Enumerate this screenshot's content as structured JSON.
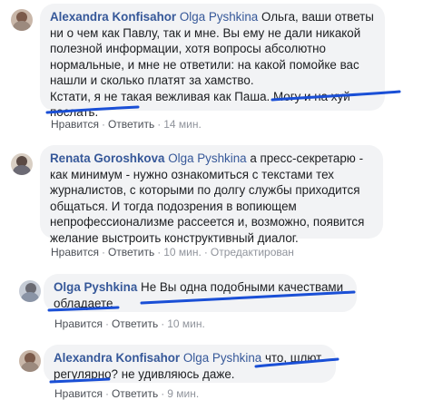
{
  "comments": [
    {
      "author": "Alexandra Konfisahor",
      "mention": "Olga Pyshkina",
      "line1_rest": " Ольга, ваши ответы",
      "lines": [
        "ни о чем как Павлу, так и мне. Вы ему не дали никакой",
        "полезной информации, хотя вопросы абсолютно",
        "нормальные, и мне не ответили: на какой помойке вас",
        "нашли и сколько платят за хамство.",
        "Кстати, я не такая вежливая как Паша. Могу и на хуй",
        "послать."
      ],
      "like": "Нравится",
      "reply": "Ответить",
      "time": "14 мин."
    },
    {
      "author": "Renata Goroshkova",
      "mention": "Olga Pyshkina",
      "line1_rest": " а пресс-секретарю -",
      "lines": [
        "как минимум - нужно ознакомиться с текстами тех",
        "журналистов, с которыми по долгу службы приходится",
        "общаться. И тогда подозрения в вопиющем",
        "непрофессионализме рассеется и, возможно, появится",
        "желание выстроить конструктивный диалог."
      ],
      "like": "Нравится",
      "reply": "Ответить",
      "time": "10 мин.",
      "edited": "Отредактирован"
    },
    {
      "author": "Olga Pyshkina",
      "line1_rest": " Не Вы одна подобными качествами",
      "lines": [
        "обладаете"
      ],
      "like": "Нравится",
      "reply": "Ответить",
      "time": "10 мин."
    },
    {
      "author": "Alexandra Konfisahor",
      "mention": "Olga Pyshkina",
      "line1_rest": " что, шлют",
      "lines": [
        "регулярно? не удивляюсь даже."
      ],
      "like": "Нравится",
      "reply": "Ответить",
      "time": "9 мин."
    }
  ]
}
